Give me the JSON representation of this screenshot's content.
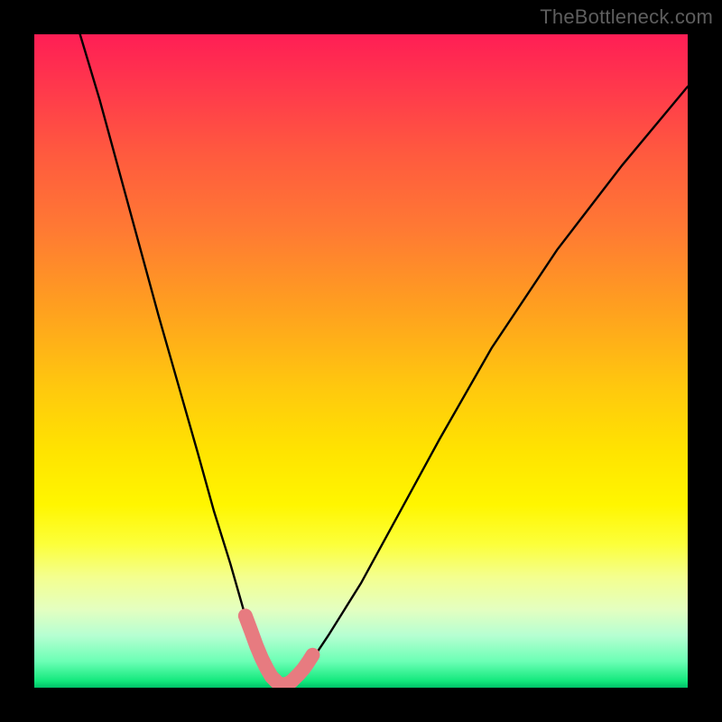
{
  "watermark": "TheBottleneck.com",
  "colors": {
    "frame": "#000000",
    "gradient_top": "#ff1e55",
    "gradient_mid": "#ffe400",
    "gradient_bottom": "#00c268",
    "curve": "#000000",
    "highlight": "#e77b80"
  },
  "chart_data": {
    "type": "line",
    "title": "",
    "xlabel": "",
    "ylabel": "",
    "xlim": [
      0,
      100
    ],
    "ylim": [
      0,
      100
    ],
    "series": [
      {
        "name": "bottleneck-curve",
        "x": [
          7,
          10,
          13,
          16,
          19,
          22,
          25,
          27.5,
          30,
          32,
          34,
          35.5,
          36.5,
          37.3,
          38.5,
          40,
          42,
          45,
          50,
          56,
          62,
          70,
          80,
          90,
          100
        ],
        "values": [
          100,
          90,
          79,
          68,
          57,
          46.5,
          36,
          27,
          19,
          12,
          6.5,
          3,
          1.3,
          0.6,
          0.6,
          1.2,
          3.5,
          8,
          16,
          27,
          38,
          52,
          67,
          80,
          92
        ]
      }
    ],
    "highlight_segments": [
      {
        "name": "left-dip-highlight",
        "x": [
          32.3,
          33.2,
          34.0,
          34.8,
          35.6,
          36.3,
          36.9
        ],
        "values": [
          11.0,
          8.6,
          6.4,
          4.5,
          2.9,
          1.7,
          1.1
        ]
      },
      {
        "name": "bottom-highlight",
        "x": [
          36.9,
          37.3,
          37.7,
          38.1,
          38.5,
          38.9,
          39.4,
          39.9,
          40.5,
          41.2,
          41.9,
          42.6
        ],
        "values": [
          1.1,
          0.7,
          0.55,
          0.5,
          0.55,
          0.7,
          1.0,
          1.5,
          2.1,
          2.9,
          3.9,
          5.0
        ]
      }
    ]
  }
}
